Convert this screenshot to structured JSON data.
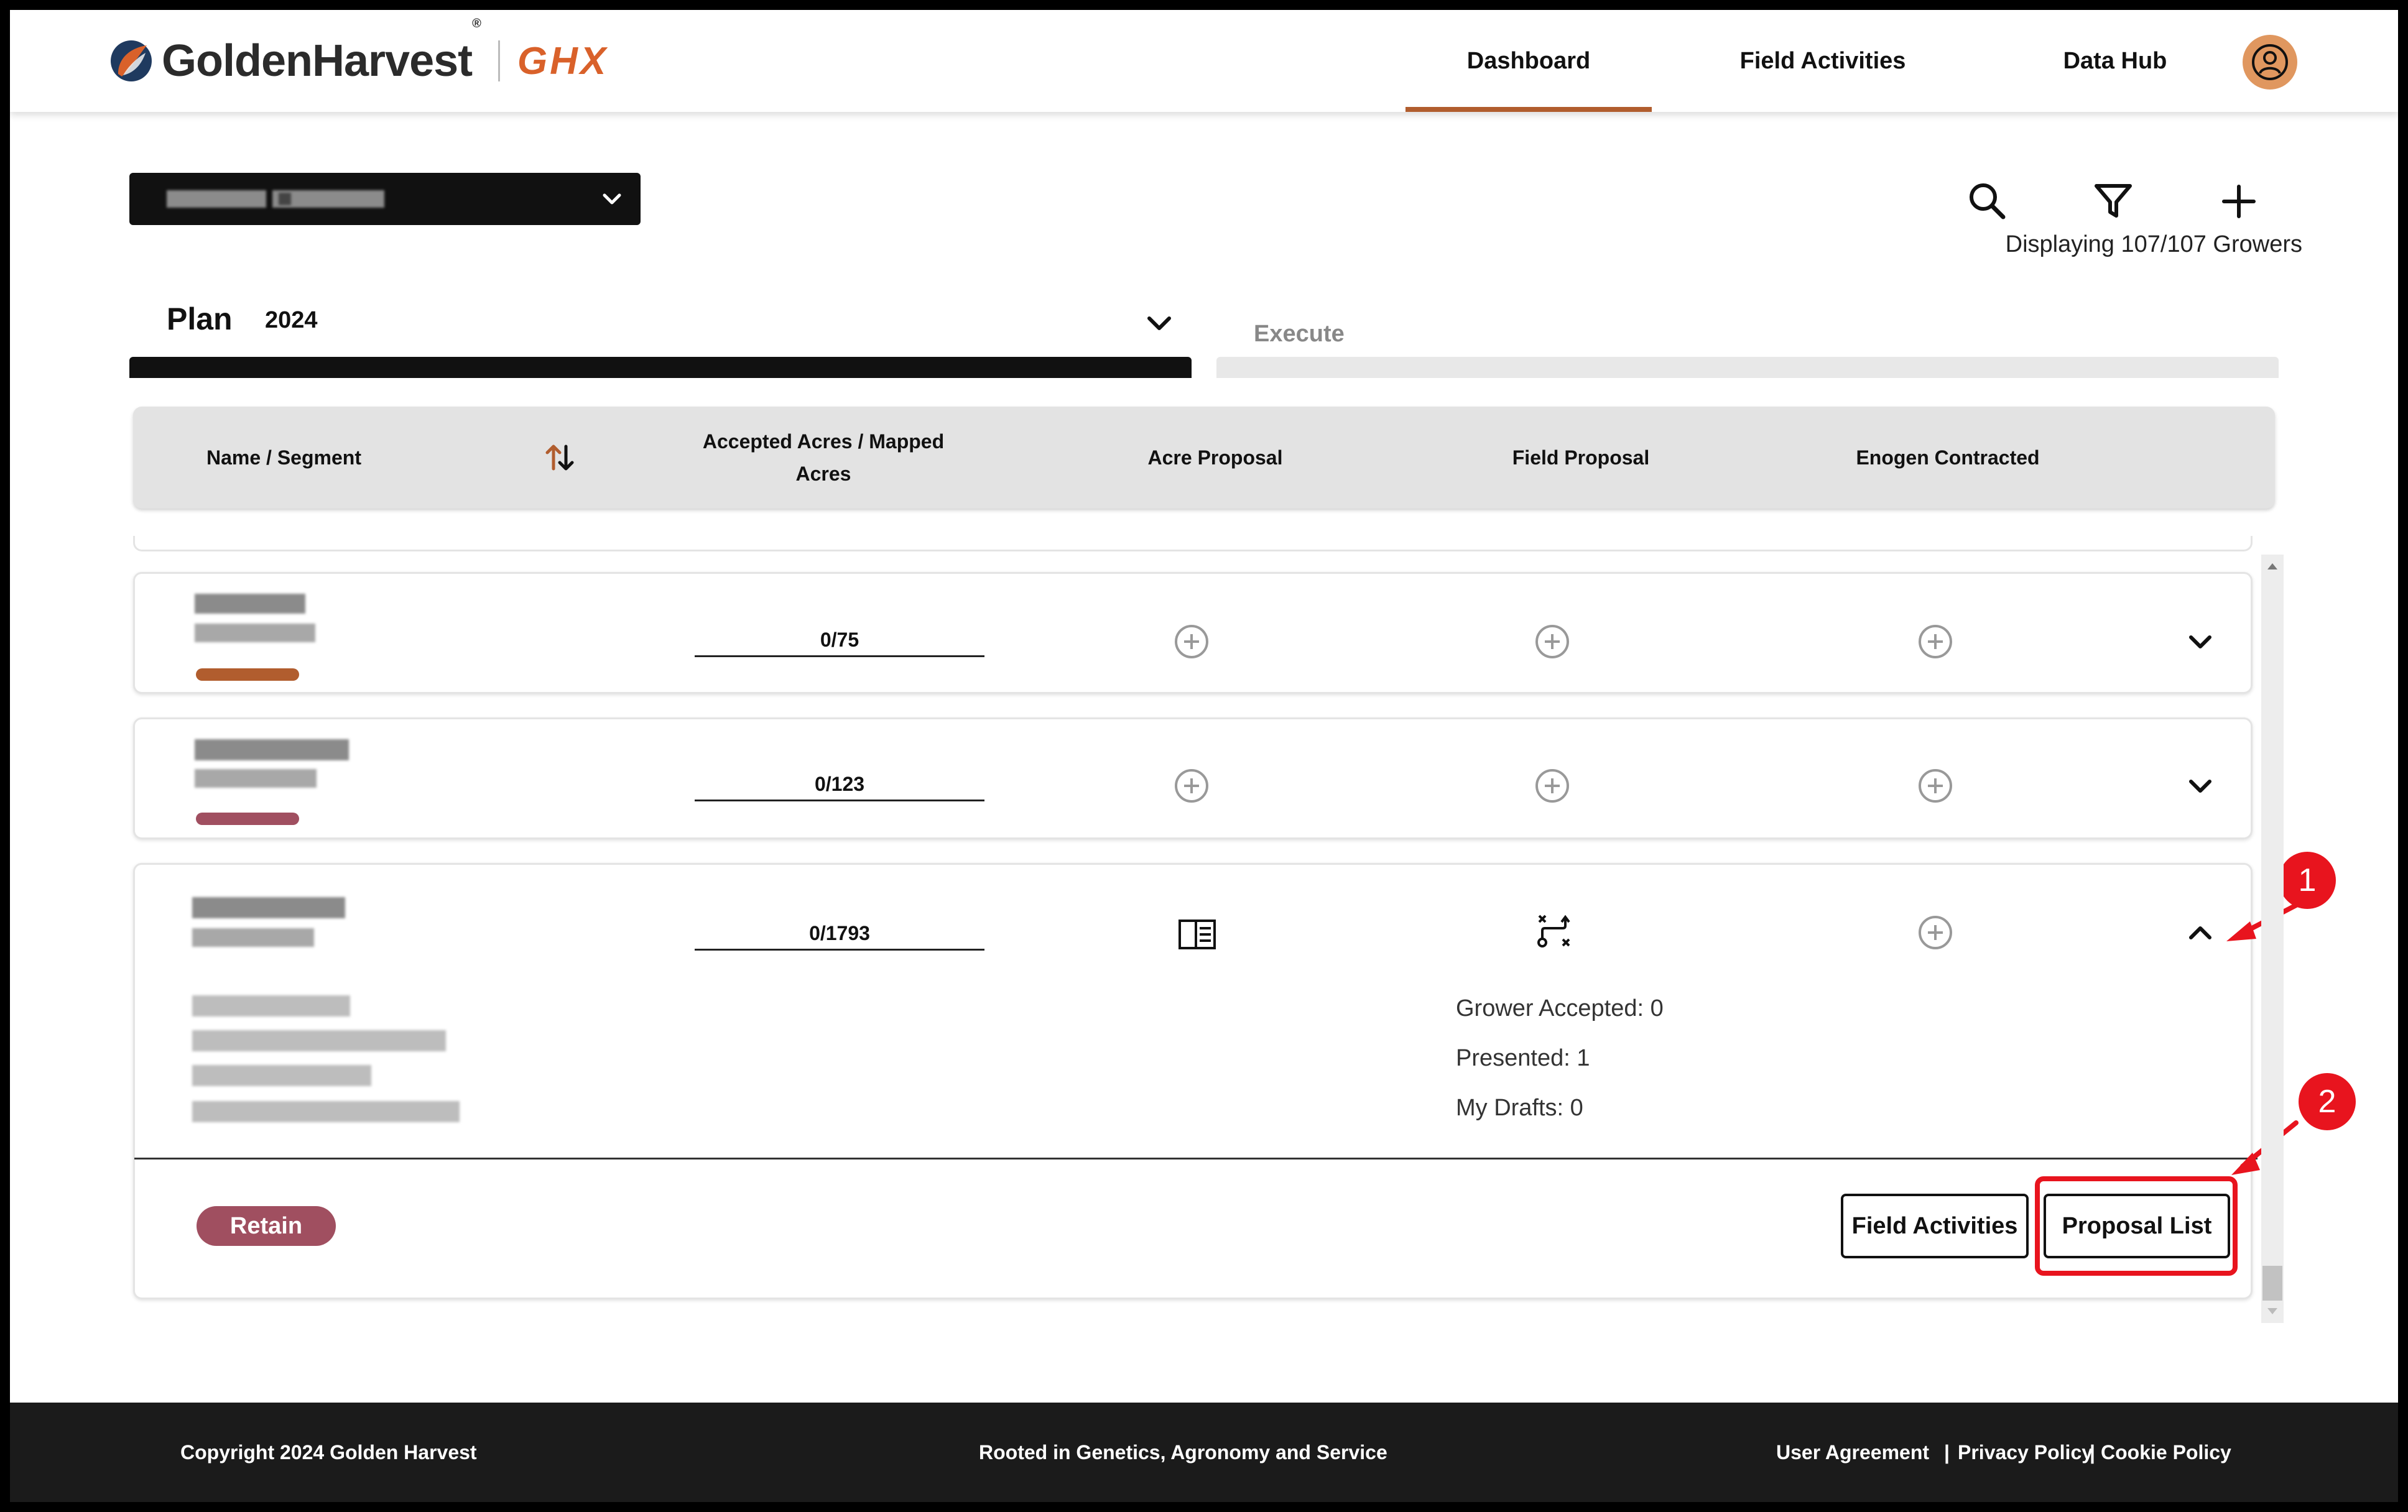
{
  "header": {
    "brand": "GoldenHarvest",
    "brand_reg": "®",
    "brand_sub": "GHX",
    "nav": {
      "dashboard": "Dashboard",
      "field_activities": "Field Activities",
      "data_hub": "Data Hub"
    },
    "avatar_icon": "user-circle-icon",
    "accent_color": "#b15d2e"
  },
  "toolbar": {
    "search_icon": "search-icon",
    "filter_icon": "filter-icon",
    "add_icon": "plus-icon",
    "displaying": "Displaying 107/107 Growers"
  },
  "tabs": {
    "plan_label": "Plan",
    "plan_year": "2024",
    "execute_label": "Execute"
  },
  "table": {
    "headers": {
      "name": "Name / Segment",
      "acres_line1": "Accepted Acres / Mapped",
      "acres_line2": "Acres",
      "acre_proposal": "Acre Proposal",
      "field_proposal": "Field Proposal",
      "enogen": "Enogen Contracted"
    },
    "rows": [
      {
        "acres": "0/75",
        "segment_color": "#b15d2e"
      },
      {
        "acres": "0/123",
        "segment_color": "#a04f60"
      },
      {
        "acres": "0/1793",
        "expanded": true,
        "stats": {
          "grower_accepted": "Grower Accepted: 0",
          "presented": "Presented: 1",
          "my_drafts": "My Drafts: 0"
        },
        "segment_badge": "Retain",
        "buttons": {
          "field_activities": "Field Activities",
          "proposal_list": "Proposal List"
        }
      }
    ]
  },
  "annotations": {
    "callout_1": "1",
    "callout_2": "2",
    "highlight_color": "#e8141e"
  },
  "footer": {
    "copyright": "Copyright 2024 Golden Harvest",
    "tagline": "Rooted in Genetics, Agronomy and Service",
    "user_agreement": "User Agreement",
    "sep1": "|",
    "privacy": "Privacy Policy",
    "sep2": "|",
    "cookie": "Cookie Policy"
  }
}
